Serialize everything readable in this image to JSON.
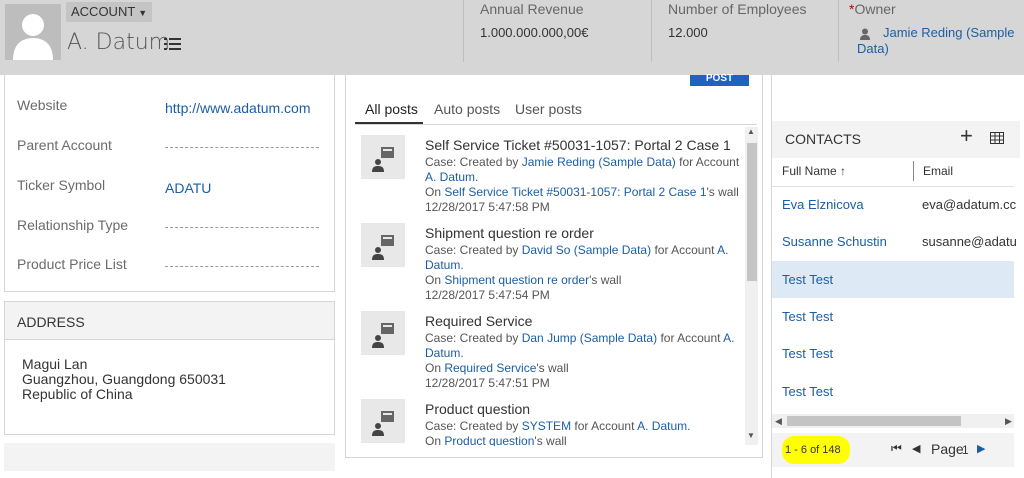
{
  "header": {
    "entity_type": "ACCOUNT",
    "record_name": "A. Datum",
    "fields": [
      {
        "label": "Annual Revenue",
        "value": "1.000.000.000,00€"
      },
      {
        "label": "Number of Employees",
        "value": "12.000"
      }
    ],
    "owner": {
      "required_mark": "*",
      "label": "Owner",
      "value": "Jamie Reding (Sample Data)"
    }
  },
  "details": {
    "fields": [
      {
        "label": "Website",
        "value": "http://www.adatum.com"
      },
      {
        "label": "Parent Account",
        "value": ""
      },
      {
        "label": "Ticker Symbol",
        "value": "ADATU"
      },
      {
        "label": "Relationship Type",
        "value": ""
      },
      {
        "label": "Product Price List",
        "value": ""
      }
    ]
  },
  "address": {
    "title": "ADDRESS",
    "lines": [
      "Magui Lan",
      "Guangzhou, Guangdong 650031",
      "Republic of China"
    ]
  },
  "posts": {
    "post_button": "POST",
    "tabs": [
      "All posts",
      "Auto posts",
      "User posts"
    ],
    "items": [
      {
        "title": "Self Service Ticket #50031-1057: Portal 2 Case 1",
        "case_prefix": "Case: Created by ",
        "author": "Jamie Reding (Sample Data)",
        "for_text": " for Account ",
        "account": "A. Datum.",
        "on_text": "On ",
        "wall_link": "Self Service Ticket #50031-1057: Portal 2 Case 1",
        "wall_suffix": "'s wall",
        "timestamp": "12/28/2017 5:47:58 PM"
      },
      {
        "title": "Shipment question re order",
        "case_prefix": "Case: Created by ",
        "author": "David So (Sample Data)",
        "for_text": " for Account ",
        "account": "A. Datum.",
        "on_text": "On ",
        "wall_link": "Shipment question re order",
        "wall_suffix": "'s wall",
        "timestamp": "12/28/2017 5:47:54 PM"
      },
      {
        "title": "Required Service",
        "case_prefix": "Case: Created by ",
        "author": "Dan Jump (Sample Data)",
        "for_text": " for Account ",
        "account": "A. Datum.",
        "on_text": "On ",
        "wall_link": "Required Service",
        "wall_suffix": "'s wall",
        "timestamp": "12/28/2017 5:47:51 PM"
      },
      {
        "title": "Product question",
        "case_prefix": "Case: Created by ",
        "author": "SYSTEM",
        "for_text": " for Account ",
        "account": "A. Datum.",
        "on_text": "On ",
        "wall_link": "Product question",
        "wall_suffix": "'s wall",
        "timestamp": ""
      }
    ]
  },
  "contacts": {
    "title": "CONTACTS",
    "col_name": "Full Name",
    "col_email": "Email",
    "rows": [
      {
        "name": "Eva Elznicova",
        "email": "eva@adatum.cc"
      },
      {
        "name": "Susanne Schustin",
        "email": "susanne@adatu"
      },
      {
        "name": "Test Test",
        "email": ""
      },
      {
        "name": "Test Test",
        "email": ""
      },
      {
        "name": "Test Test",
        "email": ""
      },
      {
        "name": "Test Test",
        "email": ""
      }
    ],
    "pager_count": "1 - 6 of 148",
    "page_label": "Page",
    "page_number": "1"
  },
  "colors": {
    "header_bg": "#d6d6d6",
    "link": "#1b5ea5",
    "post_button": "#1f62c2",
    "highlight": "#ffff00",
    "selected_row": "#dde9f5"
  }
}
